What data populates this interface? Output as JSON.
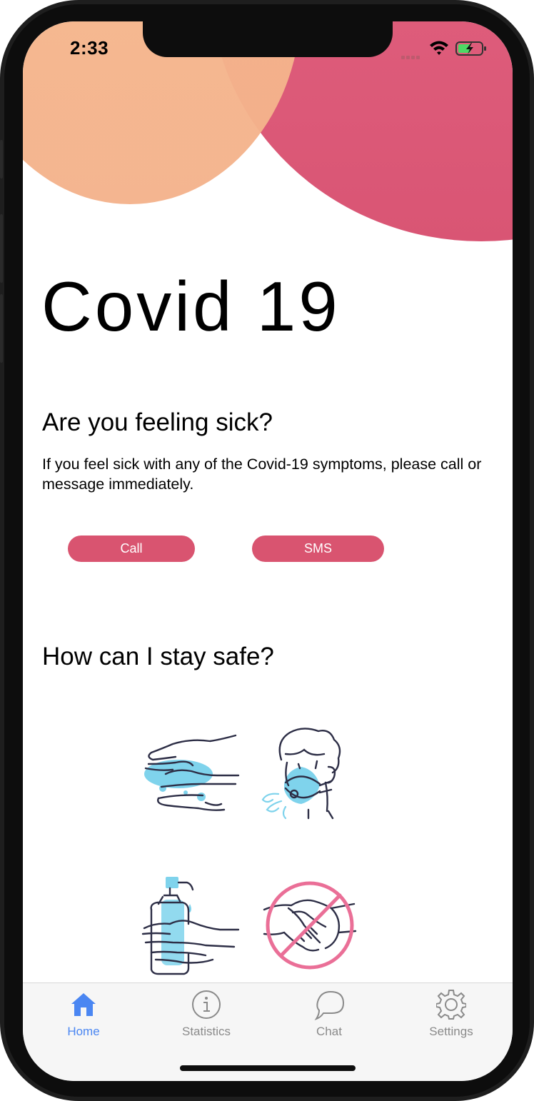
{
  "status_bar": {
    "time": "2:33",
    "icons": [
      "cellular-dots-icon",
      "wifi-icon",
      "battery-charging-icon"
    ]
  },
  "header": {
    "title": "Covid 19"
  },
  "sick_section": {
    "heading": "Are you feeling sick?",
    "body": "If you feel sick with any of the Covid-19 symptoms, please call or message immediately.",
    "call_label": "Call",
    "sms_label": "SMS"
  },
  "safe_section": {
    "heading": "How can I stay safe?",
    "illustrations": [
      "wash-hands-icon",
      "wear-mask-icon",
      "hand-sanitizer-icon",
      "no-handshake-icon"
    ]
  },
  "tab_bar": {
    "items": [
      {
        "label": "Home",
        "icon": "home-icon",
        "active": true
      },
      {
        "label": "Statistics",
        "icon": "info-icon",
        "active": false
      },
      {
        "label": "Chat",
        "icon": "chat-bubble-icon",
        "active": false
      },
      {
        "label": "Settings",
        "icon": "gear-icon",
        "active": false
      }
    ]
  },
  "colors": {
    "accent_pink": "#d95470",
    "blob_peach": "#f4b68c",
    "active_tab": "#4a86f2",
    "inactive_tab": "#8a8a8a",
    "illustration_blue": "#7fd3ec"
  }
}
